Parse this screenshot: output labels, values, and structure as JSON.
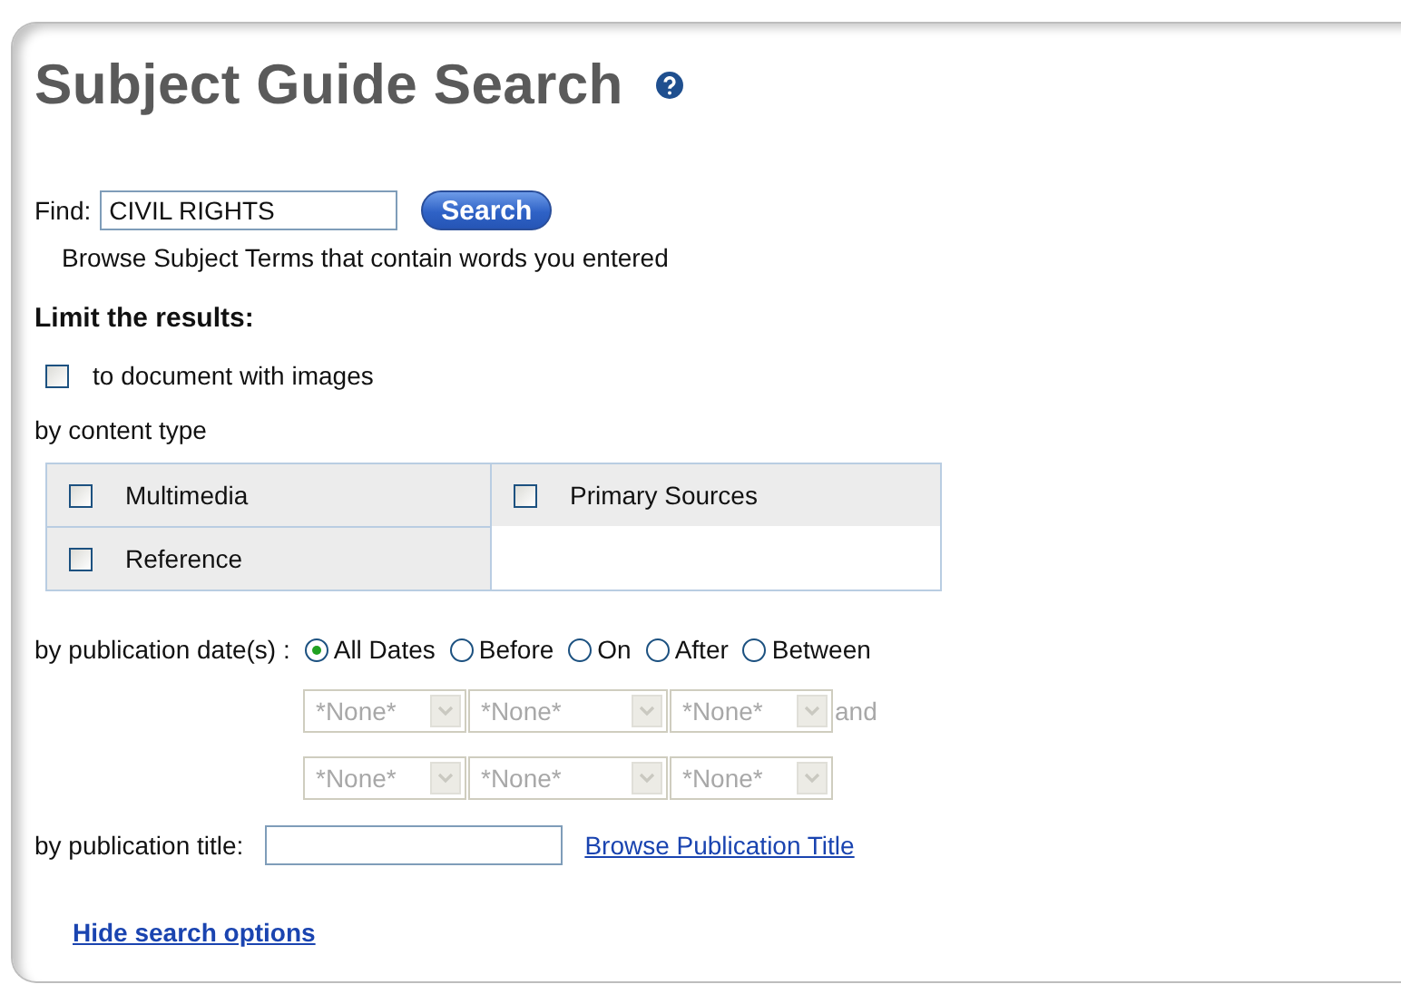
{
  "title": "Subject Guide Search",
  "find": {
    "label": "Find:",
    "value": "CIVIL RIGHTS",
    "button": "Search"
  },
  "browse_hint": "Browse Subject Terms that contain words you entered",
  "limit_heading": "Limit the results:",
  "images_option": {
    "label": "to document with images",
    "checked": false
  },
  "content_type": {
    "label": "by content type",
    "options": [
      {
        "label": "Multimedia",
        "checked": false
      },
      {
        "label": "Primary Sources",
        "checked": false
      },
      {
        "label": "Reference",
        "checked": false
      }
    ]
  },
  "publication_date": {
    "label": "by publication date(s) :",
    "options": [
      {
        "label": "All Dates",
        "selected": true
      },
      {
        "label": "Before",
        "selected": false
      },
      {
        "label": "On",
        "selected": false
      },
      {
        "label": "After",
        "selected": false
      },
      {
        "label": "Between",
        "selected": false
      }
    ],
    "rows": [
      {
        "selects": [
          {
            "value": "*None*",
            "disabled": true
          },
          {
            "value": "*None*",
            "disabled": true
          },
          {
            "value": "*None*",
            "disabled": true
          }
        ],
        "suffix": "and"
      },
      {
        "selects": [
          {
            "value": "*None*",
            "disabled": true
          },
          {
            "value": "*None*",
            "disabled": true
          },
          {
            "value": "*None*",
            "disabled": true
          }
        ]
      }
    ]
  },
  "publication_title": {
    "label": "by publication title:",
    "link": "Browse Publication Title"
  },
  "hide_link": "Hide search options"
}
